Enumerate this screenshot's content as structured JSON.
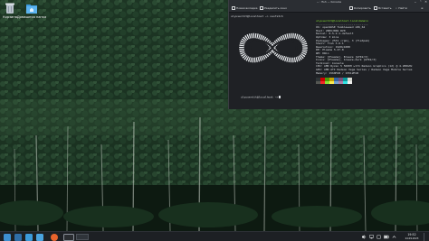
{
  "desktop": {
    "icons": [
      {
        "label": "Корзина",
        "icon": "trash-icon"
      },
      {
        "label": "Домашняя папка",
        "icon": "home-folder-icon"
      }
    ]
  },
  "terminal": {
    "title": "~ : fish — Konsole",
    "toolbar": {
      "new_tab": "Новая вкладка",
      "split": "Разделить окно",
      "copy": "Копировать",
      "paste": "Вставить",
      "find": "Найти",
      "menu": "≡"
    },
    "prompt1": "ulyuserdit@localhost ~> neofetch",
    "prompt2": "ulyuserdit@localhost ~>",
    "user_host": "ulyuserdit@localhost.localdomain",
    "separator": "--------------------------------",
    "info": [
      "OS: openSUSE Tumbleweed x86_64",
      "Host: 20RVJ00Q RV0",
      "Kernel: 6.5.2-1-default",
      "Uptime: 3 mins",
      "Packages: 2531 (rpm), 3 (flatpak)",
      "Shell: fish 3.6.1",
      "Resolution: 1920x1080",
      "DE: Plasma 5.27.8",
      "WM: KWin",
      "Theme: [Plasma], Breeze [GTK2/3]",
      "Icons: [Plasma], breeze-dark [GTK2/3]",
      "Terminal: konsole",
      "CPU: AMD Ryzen 5 5600H with Radeon Graphics (12) @ 4.280GHz",
      "GPU: AMD ATI Radeon Vega Series / Radeon Vega Mobile Series",
      "Memory: 1560MiB / 15512MiB"
    ],
    "palette": [
      "#2e3436",
      "#cc0000",
      "#4e9a06",
      "#c4a000",
      "#3465a4",
      "#75507b",
      "#06989a",
      "#d3d7cf",
      "#555753",
      "#ef2929",
      "#8ae234",
      "#fce94f",
      "#729fcf",
      "#ad7fa8",
      "#34e2e2",
      "#eeeeec"
    ]
  },
  "taskbar": {
    "apps": [
      {
        "name": "app-launcher-icon",
        "color": "#3d8fd1"
      },
      {
        "name": "system-settings-icon",
        "color": "#2f6ea8"
      },
      {
        "name": "discover-store-icon",
        "color": "#3b9bdb"
      },
      {
        "name": "dolphin-files-icon",
        "color": "#4aa3df"
      },
      {
        "name": "firefox-icon",
        "color": "#e8642c"
      },
      {
        "name": "konsole-icon",
        "color": "#2a2d31"
      }
    ],
    "clock_time": "19:52",
    "clock_date": "24.09.2023"
  }
}
